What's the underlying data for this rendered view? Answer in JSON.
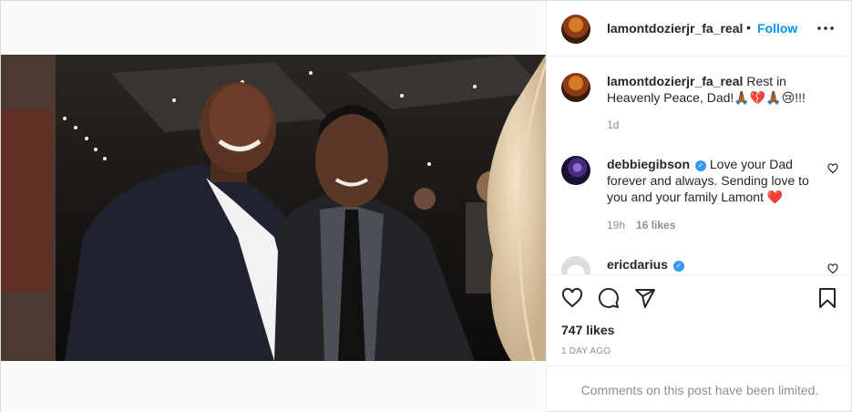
{
  "post": {
    "author": "lamontdozierjr_fa_real",
    "follow_label": "Follow",
    "separator": "•",
    "caption": "Rest in Heavenly Peace, Dad!🙏🏾💔🙏🏾😢!!!",
    "caption_time": "1d"
  },
  "comments": [
    {
      "username": "debbiegibson",
      "verified": true,
      "text": "Love your Dad forever and always. Sending love to you and your family Lamont ❤️",
      "time": "19h",
      "likes": "16 likes"
    },
    {
      "username": "ericdarius",
      "verified": true
    }
  ],
  "stats": {
    "likes": "747 likes",
    "date": "1 DAY AGO"
  },
  "footer": {
    "limited_text": "Comments on this post have been limited."
  },
  "icons": [
    "more-options-icon",
    "heart-icon",
    "comment-icon",
    "share-icon",
    "bookmark-icon",
    "verified-badge-icon"
  ],
  "colors": {
    "accent": "#0095f6",
    "verified": "#3897f0",
    "muted": "#8e8e8e",
    "text": "#262626",
    "heart": "#ed4956"
  }
}
